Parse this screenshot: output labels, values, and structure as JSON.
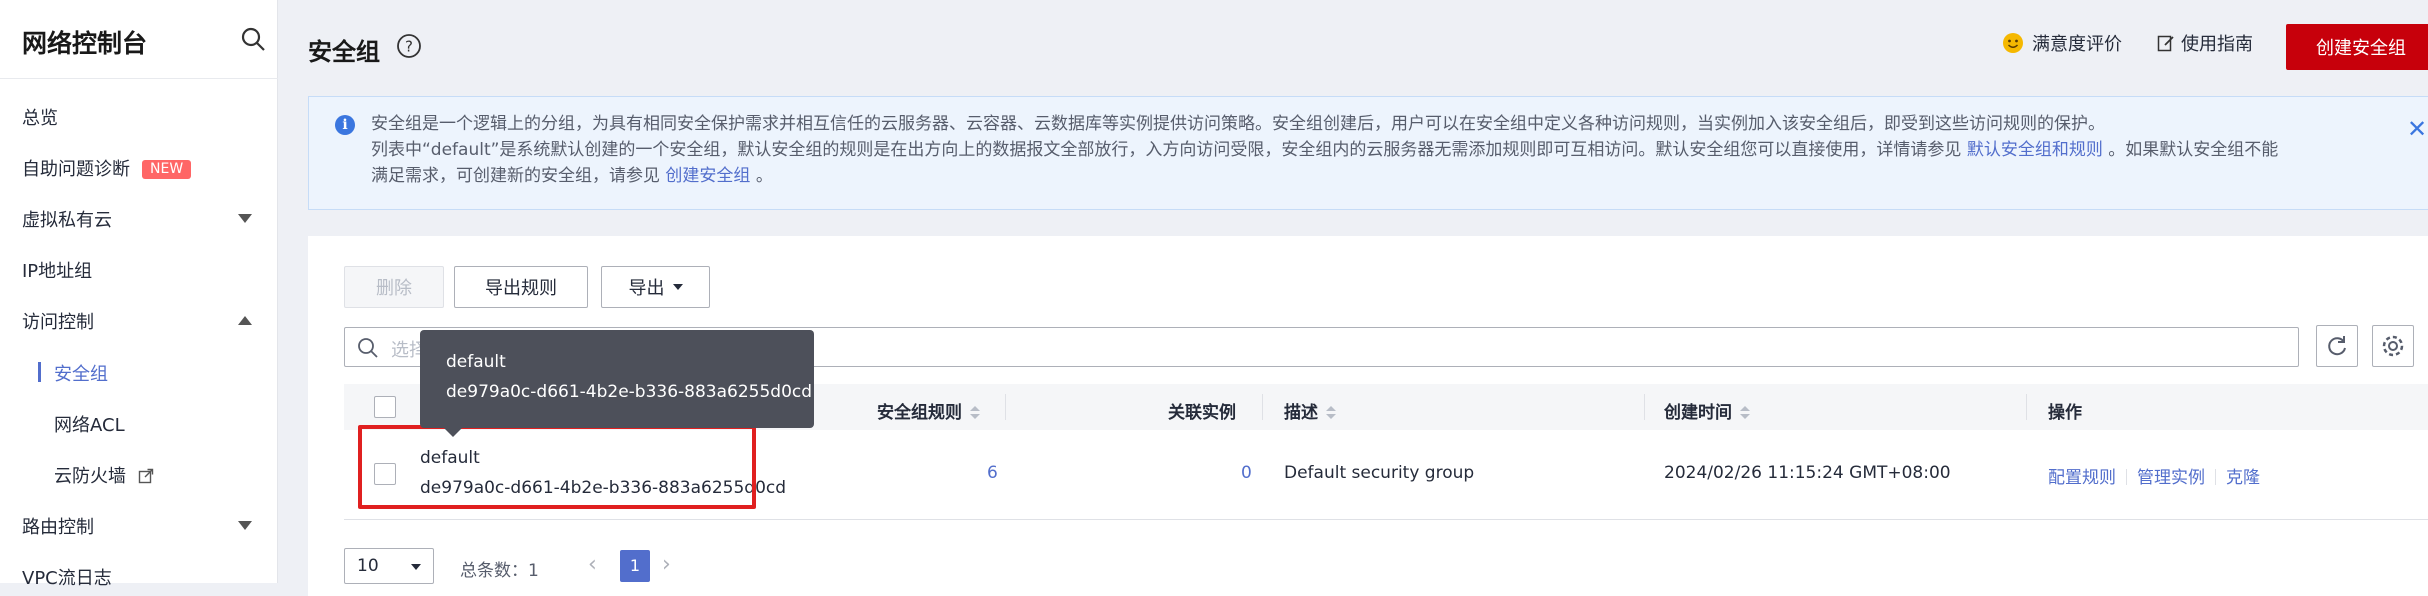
{
  "sidebar": {
    "title": "网络控制台",
    "items": [
      {
        "label": "总览"
      },
      {
        "label": "自助问题诊断",
        "badge": "NEW"
      },
      {
        "label": "虚拟私有云"
      },
      {
        "label": "IP地址组"
      },
      {
        "label": "访问控制"
      },
      {
        "label": "安全组"
      },
      {
        "label": "网络ACL"
      },
      {
        "label": "云防火墙"
      },
      {
        "label": "路由控制"
      },
      {
        "label": "VPC流日志"
      }
    ]
  },
  "header": {
    "title": "安全组",
    "satisfaction": "满意度评价",
    "guide": "使用指南",
    "create": "创建安全组"
  },
  "notice": {
    "line1": "安全组是一个逻辑上的分组，为具有相同安全保护需求并相互信任的云服务器、云容器、云数据库等实例提供访问策略。安全组创建后，用户可以在安全组中定义各种访问规则，当实例加入该安全组后，即受到这些访问规则的保护。",
    "line2": "列表中“default”是系统默认创建的一个安全组，默认安全组的规则是在出方向上的数据报文全部放行，入方向访问受限，安全组内的云服务器无需添加规则即可互相访问。默认安全组您可以直接使用，详情请参见",
    "line2_link": "默认安全组和规则",
    "line2_tail": "。如果默认安全组不能",
    "line3": "满足需求，可创建新的安全组，请参见",
    "line3_link": "创建安全组",
    "line3_tail": "。"
  },
  "toolbar": {
    "delete": "删除",
    "export_rules": "导出规则",
    "export": "导出"
  },
  "search": {
    "placeholder": "选择"
  },
  "table": {
    "headers": {
      "rules": "安全组规则",
      "instances": "关联实例",
      "desc": "描述",
      "created": "创建时间",
      "ops": "操作"
    },
    "rows": [
      {
        "name": "default",
        "id": "de979a0c-d661-4b2e-b336-883a6255d0cd",
        "rules": "6",
        "instances": "0",
        "desc": "Default security group",
        "created": "2024/02/26 11:15:24 GMT+08:00",
        "ops": [
          "配置规则",
          "管理实例",
          "克隆"
        ]
      }
    ]
  },
  "tooltip": {
    "name": "default",
    "id": "de979a0c-d661-4b2e-b336-883a6255d0cd"
  },
  "pagination": {
    "page_size": "10",
    "total": "总条数：1",
    "current": "1"
  },
  "colors": {
    "brand_red": "#c7000b",
    "link": "#526ecc",
    "highlight": "#e02020"
  }
}
